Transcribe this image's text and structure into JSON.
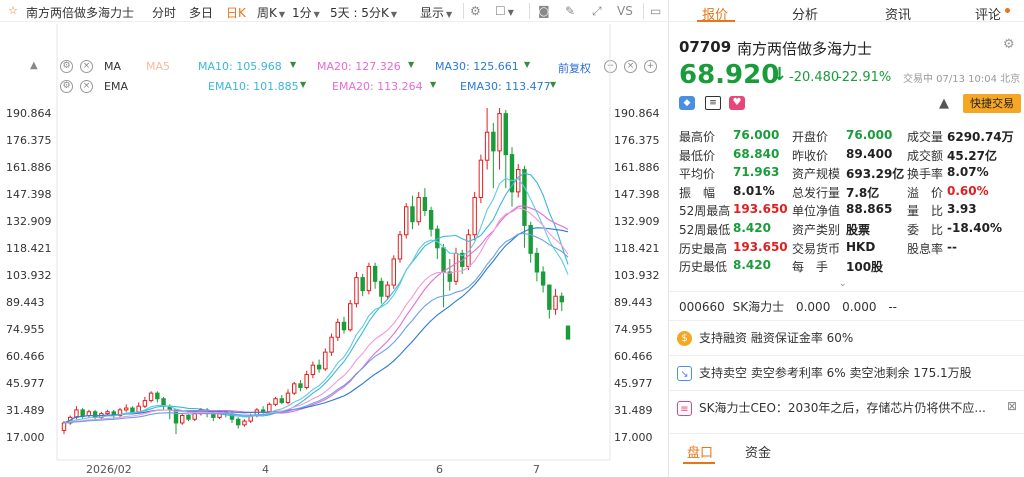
{
  "toolbar": {
    "title": "南方两倍做多海力士",
    "tabs": [
      "分时",
      "多日",
      "日K",
      "周K",
      "1分",
      "5天 : 5分K",
      "显示"
    ],
    "active_tab": "日K",
    "vs_label": "VS"
  },
  "indicators": {
    "ma_label": "MA",
    "ma5_label": "MA5",
    "ma10": "MA10: 105.968",
    "ma20": "MA20: 127.326",
    "ma30": "MA30: 125.661",
    "ema_label": "EMA",
    "ema10": "EMA10: 101.885",
    "ema20": "EMA20: 113.264",
    "ema30": "EMA30: 113.477",
    "adjust_label": "前复权"
  },
  "y_axis": [
    "190.864",
    "176.375",
    "161.886",
    "147.398",
    "132.909",
    "118.421",
    "103.932",
    "89.443",
    "74.955",
    "60.466",
    "45.977",
    "31.489",
    "17.000"
  ],
  "x_axis": [
    "2026/02",
    "4",
    "6",
    "7"
  ],
  "colors": {
    "up": "#e02020",
    "down": "#1a9c3a",
    "ma5": "#f5b9a0",
    "ma10": "#3ab8d8",
    "ma20": "#e56bd6",
    "ma30": "#2a7ad6",
    "accent": "#e8751a"
  },
  "right_panel": {
    "tabs": [
      "报价",
      "分析",
      "资讯",
      "评论"
    ],
    "active_tab": "报价",
    "code": "07709",
    "name": "南方两倍做多海力士",
    "price": "68.920",
    "arrow": "↓",
    "change": "-20.480",
    "change_pct": "-22.91%",
    "trade_time": "交易中 07/13 10:04 北京",
    "quick_trade": "快捷交易",
    "stats_col1": [
      {
        "k": "最高价",
        "v": "76.000",
        "c": "green"
      },
      {
        "k": "最低价",
        "v": "68.840",
        "c": "green"
      },
      {
        "k": "平均价",
        "v": "71.963",
        "c": "green"
      },
      {
        "k": "振　幅",
        "v": "8.01%",
        "c": "dark"
      },
      {
        "k": "52周最高",
        "v": "193.650",
        "c": "red"
      },
      {
        "k": "52周最低",
        "v": "8.420",
        "c": "green"
      },
      {
        "k": "历史最高",
        "v": "193.650",
        "c": "red"
      },
      {
        "k": "历史最低",
        "v": "8.420",
        "c": "green"
      }
    ],
    "stats_col2": [
      {
        "k": "开盘价",
        "v": "76.000",
        "c": "green"
      },
      {
        "k": "昨收价",
        "v": "89.400",
        "c": "dark"
      },
      {
        "k": "资产规模",
        "v": "693.29亿",
        "c": "dark"
      },
      {
        "k": "总发行量",
        "v": "7.8亿",
        "c": "dark"
      },
      {
        "k": "单位净值",
        "v": "88.865",
        "c": "dark"
      },
      {
        "k": "资产类别",
        "v": "股票",
        "c": "dark"
      },
      {
        "k": "交易货币",
        "v": "HKD",
        "c": "dark"
      },
      {
        "k": "每　手",
        "v": "100股",
        "c": "dark"
      }
    ],
    "stats_col3": [
      {
        "k": "成交量",
        "v": "6290.74万",
        "c": "dark"
      },
      {
        "k": "成交额",
        "v": "45.27亿",
        "c": "dark"
      },
      {
        "k": "换手率",
        "v": "8.07%",
        "c": "dark"
      },
      {
        "k": "溢　价",
        "v": "0.60%",
        "c": "red"
      },
      {
        "k": "量　比",
        "v": "3.93",
        "c": "dark"
      },
      {
        "k": "委　比",
        "v": "-18.40%",
        "c": "dark"
      },
      {
        "k": "股息率",
        "v": "--",
        "c": "dark"
      }
    ],
    "underlying": {
      "code": "000660",
      "name": "SK海力士",
      "v1": "0.000",
      "v2": "0.000",
      "v3": "--"
    },
    "features": [
      "支持融资  融资保证金率 60%",
      "支持卖空  卖空参考利率 6%  卖空池剩余 175.1万股",
      "SK海力士CEO：2030年之后，存储芯片仍将供不应..."
    ],
    "bottom_tabs": [
      "盘口",
      "资金"
    ]
  },
  "chart_data": {
    "type": "candlestick",
    "ylim": [
      17.0,
      190.864
    ],
    "x_ticks": [
      "2026/02",
      "4",
      "6",
      "7"
    ],
    "candles": [
      {
        "o": 20,
        "c": 24,
        "h": 25,
        "l": 18
      },
      {
        "o": 24,
        "c": 27,
        "h": 28,
        "l": 23
      },
      {
        "o": 27,
        "c": 31,
        "h": 33,
        "l": 26
      },
      {
        "o": 31,
        "c": 28,
        "h": 32,
        "l": 26
      },
      {
        "o": 28,
        "c": 30,
        "h": 31,
        "l": 27
      },
      {
        "o": 30,
        "c": 27,
        "h": 31,
        "l": 25
      },
      {
        "o": 27,
        "c": 29,
        "h": 30,
        "l": 26
      },
      {
        "o": 29,
        "c": 30,
        "h": 31,
        "l": 28
      },
      {
        "o": 30,
        "c": 28,
        "h": 31,
        "l": 26
      },
      {
        "o": 28,
        "c": 31,
        "h": 32,
        "l": 27
      },
      {
        "o": 31,
        "c": 32,
        "h": 34,
        "l": 30
      },
      {
        "o": 32,
        "c": 30,
        "h": 33,
        "l": 29
      },
      {
        "o": 30,
        "c": 33,
        "h": 35,
        "l": 29
      },
      {
        "o": 33,
        "c": 36,
        "h": 38,
        "l": 32
      },
      {
        "o": 36,
        "c": 40,
        "h": 41,
        "l": 35
      },
      {
        "o": 40,
        "c": 37,
        "h": 41,
        "l": 35
      },
      {
        "o": 37,
        "c": 33,
        "h": 38,
        "l": 31
      },
      {
        "o": 33,
        "c": 31,
        "h": 34,
        "l": 26
      },
      {
        "o": 31,
        "c": 24,
        "h": 31,
        "l": 18
      },
      {
        "o": 24,
        "c": 28,
        "h": 29,
        "l": 23
      },
      {
        "o": 28,
        "c": 26,
        "h": 29,
        "l": 25
      },
      {
        "o": 26,
        "c": 29,
        "h": 30,
        "l": 25
      },
      {
        "o": 29,
        "c": 31,
        "h": 32,
        "l": 28
      },
      {
        "o": 31,
        "c": 29,
        "h": 32,
        "l": 27
      },
      {
        "o": 29,
        "c": 27,
        "h": 30,
        "l": 25
      },
      {
        "o": 27,
        "c": 30,
        "h": 31,
        "l": 26
      },
      {
        "o": 30,
        "c": 29,
        "h": 31,
        "l": 27
      },
      {
        "o": 29,
        "c": 26,
        "h": 30,
        "l": 24
      },
      {
        "o": 26,
        "c": 23,
        "h": 27,
        "l": 21
      },
      {
        "o": 23,
        "c": 25,
        "h": 26,
        "l": 22
      },
      {
        "o": 25,
        "c": 28,
        "h": 29,
        "l": 24
      },
      {
        "o": 28,
        "c": 31,
        "h": 32,
        "l": 27
      },
      {
        "o": 31,
        "c": 30,
        "h": 33,
        "l": 29
      },
      {
        "o": 30,
        "c": 34,
        "h": 35,
        "l": 29
      },
      {
        "o": 34,
        "c": 37,
        "h": 38,
        "l": 33
      },
      {
        "o": 37,
        "c": 35,
        "h": 39,
        "l": 34
      },
      {
        "o": 35,
        "c": 40,
        "h": 42,
        "l": 34
      },
      {
        "o": 40,
        "c": 45,
        "h": 46,
        "l": 39
      },
      {
        "o": 45,
        "c": 43,
        "h": 47,
        "l": 41
      },
      {
        "o": 43,
        "c": 50,
        "h": 52,
        "l": 42
      },
      {
        "o": 50,
        "c": 55,
        "h": 57,
        "l": 48
      },
      {
        "o": 55,
        "c": 53,
        "h": 58,
        "l": 51
      },
      {
        "o": 53,
        "c": 62,
        "h": 64,
        "l": 52
      },
      {
        "o": 62,
        "c": 70,
        "h": 72,
        "l": 60
      },
      {
        "o": 70,
        "c": 78,
        "h": 80,
        "l": 68
      },
      {
        "o": 78,
        "c": 74,
        "h": 81,
        "l": 72
      },
      {
        "o": 74,
        "c": 88,
        "h": 90,
        "l": 73
      },
      {
        "o": 88,
        "c": 102,
        "h": 105,
        "l": 86
      },
      {
        "o": 102,
        "c": 95,
        "h": 104,
        "l": 92
      },
      {
        "o": 95,
        "c": 108,
        "h": 110,
        "l": 93
      },
      {
        "o": 108,
        "c": 100,
        "h": 110,
        "l": 96
      },
      {
        "o": 100,
        "c": 92,
        "h": 102,
        "l": 88
      },
      {
        "o": 92,
        "c": 98,
        "h": 100,
        "l": 90
      },
      {
        "o": 98,
        "c": 112,
        "h": 114,
        "l": 96
      },
      {
        "o": 112,
        "c": 125,
        "h": 127,
        "l": 110
      },
      {
        "o": 125,
        "c": 140,
        "h": 142,
        "l": 123
      },
      {
        "o": 140,
        "c": 132,
        "h": 146,
        "l": 128
      },
      {
        "o": 132,
        "c": 145,
        "h": 148,
        "l": 130
      },
      {
        "o": 145,
        "c": 138,
        "h": 150,
        "l": 135
      },
      {
        "o": 138,
        "c": 128,
        "h": 140,
        "l": 124
      },
      {
        "o": 128,
        "c": 118,
        "h": 130,
        "l": 112
      },
      {
        "o": 118,
        "c": 105,
        "h": 120,
        "l": 86
      },
      {
        "o": 105,
        "c": 100,
        "h": 112,
        "l": 95
      },
      {
        "o": 100,
        "c": 115,
        "h": 118,
        "l": 98
      },
      {
        "o": 115,
        "c": 108,
        "h": 117,
        "l": 104
      },
      {
        "o": 108,
        "c": 125,
        "h": 128,
        "l": 106
      },
      {
        "o": 125,
        "c": 145,
        "h": 148,
        "l": 122
      },
      {
        "o": 145,
        "c": 165,
        "h": 168,
        "l": 142
      },
      {
        "o": 165,
        "c": 180,
        "h": 193,
        "l": 160
      },
      {
        "o": 180,
        "c": 170,
        "h": 185,
        "l": 150
      },
      {
        "o": 170,
        "c": 190,
        "h": 193,
        "l": 160
      },
      {
        "o": 190,
        "c": 168,
        "h": 192,
        "l": 150
      },
      {
        "o": 168,
        "c": 148,
        "h": 172,
        "l": 140
      },
      {
        "o": 148,
        "c": 160,
        "h": 163,
        "l": 145
      },
      {
        "o": 160,
        "c": 130,
        "h": 162,
        "l": 118
      },
      {
        "o": 130,
        "c": 115,
        "h": 132,
        "l": 110
      },
      {
        "o": 115,
        "c": 105,
        "h": 118,
        "l": 100
      },
      {
        "o": 105,
        "c": 98,
        "h": 108,
        "l": 94
      },
      {
        "o": 98,
        "c": 85,
        "h": 98,
        "l": 80
      },
      {
        "o": 85,
        "c": 92,
        "h": 96,
        "l": 82
      },
      {
        "o": 92,
        "c": 89,
        "h": 94,
        "l": 84
      },
      {
        "o": 76,
        "c": 69,
        "h": 76,
        "l": 68.84
      }
    ]
  }
}
